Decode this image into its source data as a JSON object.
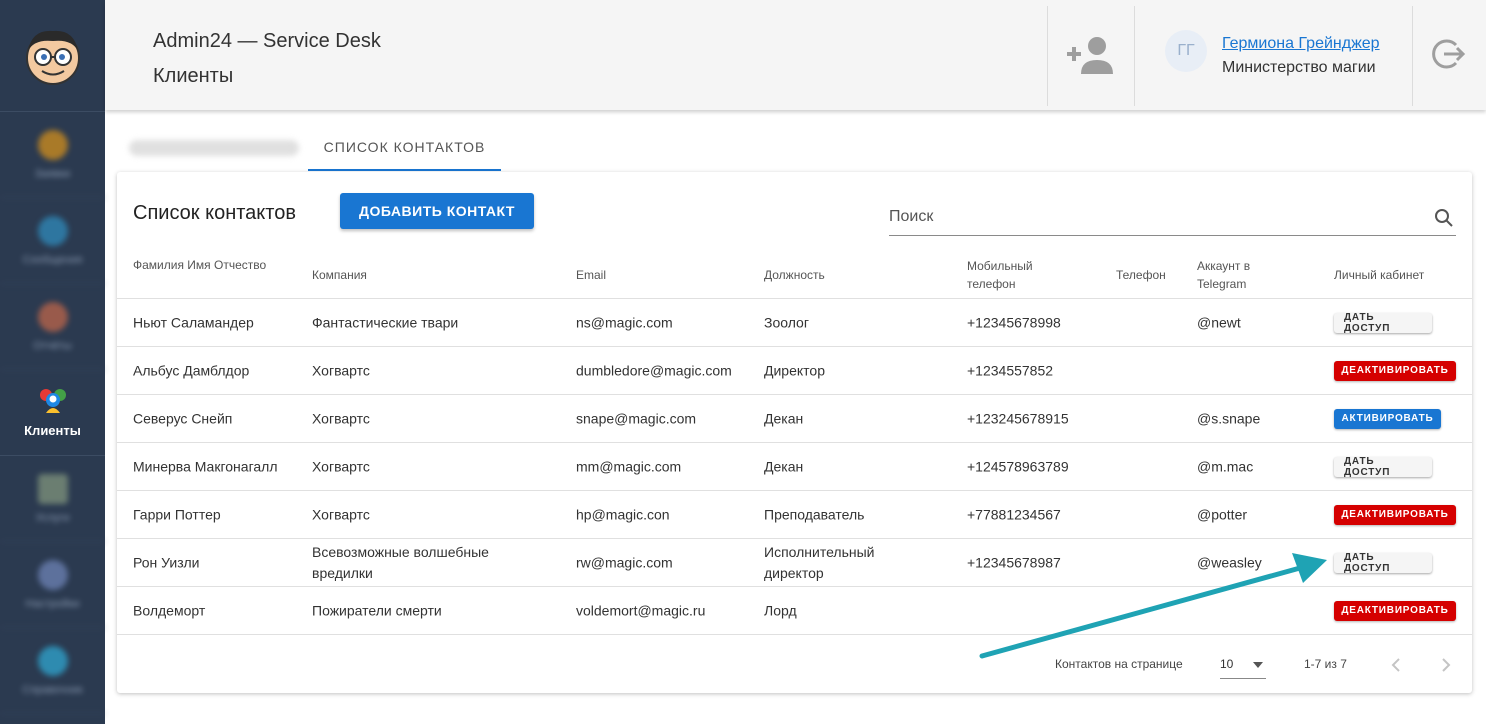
{
  "header": {
    "app_title": "Admin24 — Service Desk",
    "section_title": "Клиенты",
    "user_initials": "ГГ",
    "user_name": "Гермиона Грейнджер",
    "user_org": "Министерство магии"
  },
  "sidebar": {
    "active_label": "Клиенты",
    "blurred_labels": [
      "Заявки",
      "Сообщения",
      "Отчёты",
      "Услуги",
      "Настройки",
      "Справочник"
    ]
  },
  "tabs": {
    "contacts_label": "СПИСОК КОНТАКТОВ"
  },
  "card": {
    "title": "Список контактов",
    "add_button_label": "ДОБАВИТЬ КОНТАКТ",
    "search_placeholder": "Поиск"
  },
  "table": {
    "columns": {
      "name": "Фамилия Имя Отчество",
      "company": "Компания",
      "email": "Email",
      "position": "Должность",
      "mobile": "Мобильный телефон",
      "phone": "Телефон",
      "telegram": "Аккаунт в Telegram",
      "cabinet": "Личный кабинет"
    },
    "rows": [
      {
        "name": "Ньют Саламандер",
        "company": "Фантастические твари",
        "email": "ns@magic.com",
        "position": "Зоолог",
        "mobile": "+12345678998",
        "phone": "",
        "telegram": "@newt",
        "action": "ДАТЬ ДОСТУП",
        "action_type": "grant"
      },
      {
        "name": "Альбус Дамблдор",
        "company": "Хогвартс",
        "email": "dumbledore@magic.com",
        "position": "Директор",
        "mobile": "+1234557852",
        "phone": "",
        "telegram": "",
        "action": "ДЕАКТИВИРОВАТЬ",
        "action_type": "deact"
      },
      {
        "name": "Северус Снейп",
        "company": "Хогвартс",
        "email": "snape@magic.com",
        "position": "Декан",
        "mobile": "+123245678915",
        "phone": "",
        "telegram": "@s.snape",
        "action": "АКТИВИРОВАТЬ",
        "action_type": "act"
      },
      {
        "name": "Минерва Макгонагалл",
        "company": "Хогвартс",
        "email": "mm@magic.com",
        "position": "Декан",
        "mobile": "+124578963789",
        "phone": "",
        "telegram": "@m.mac",
        "action": "ДАТЬ ДОСТУП",
        "action_type": "grant"
      },
      {
        "name": "Гарри Поттер",
        "company": "Хогвартс",
        "email": "hp@magic.con",
        "position": "Преподаватель",
        "mobile": "+77881234567",
        "phone": "",
        "telegram": "@potter",
        "action": "ДЕАКТИВИРОВАТЬ",
        "action_type": "deact"
      },
      {
        "name": "Рон Уизли",
        "company": "Всевозможные волшебные вредилки",
        "email": "rw@magic.com",
        "position": "Исполнительный директор",
        "mobile": "+12345678987",
        "phone": "",
        "telegram": "@weasley",
        "action": "ДАТЬ ДОСТУП",
        "action_type": "grant"
      },
      {
        "name": "Волдеморт",
        "company": "Пожиратели смерти",
        "email": "voldemort@magic.ru",
        "position": "Лорд",
        "mobile": "",
        "phone": "",
        "telegram": "",
        "action": "ДЕАКТИВИРОВАТЬ",
        "action_type": "deact"
      }
    ]
  },
  "footer": {
    "per_page_label": "Контактов на странице",
    "per_page_value": "10",
    "range": "1-7 из 7"
  },
  "colors": {
    "primary": "#1976d2",
    "danger": "#d50000",
    "sidebar": "#2b3a50",
    "annotation_arrow": "#1fa3b4"
  },
  "icons": {
    "add_user": "person-add-icon",
    "logout": "logout-icon",
    "search": "search-icon",
    "prev": "chevron-left-icon",
    "next": "chevron-right-icon",
    "dropdown": "arrow-drop-down-icon"
  }
}
